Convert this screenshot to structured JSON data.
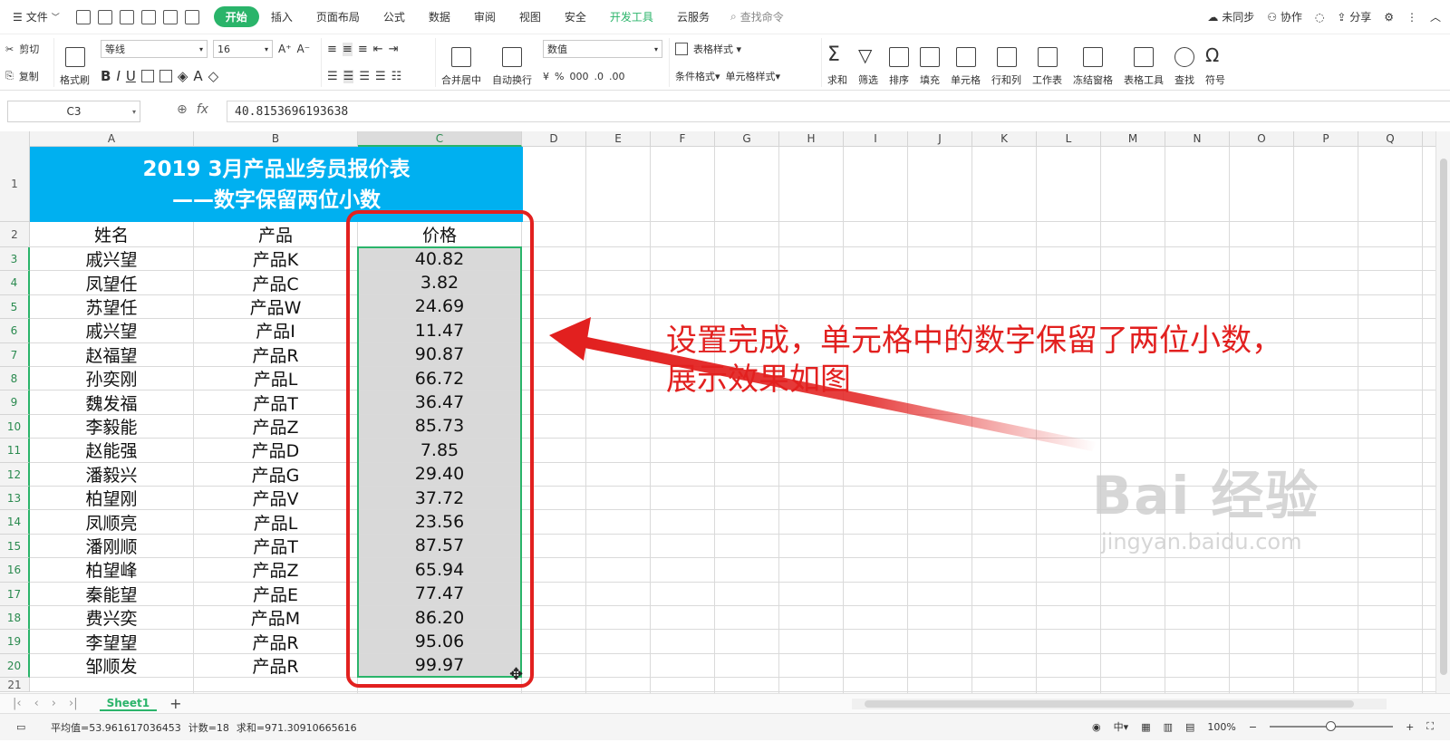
{
  "menu": {
    "file_label": "文件",
    "tabs": [
      "开始",
      "插入",
      "页面布局",
      "公式",
      "数据",
      "审阅",
      "视图",
      "安全",
      "开发工具",
      "云服务"
    ],
    "search_label": "查找命令",
    "right": {
      "sync": "未同步",
      "collab": "协作",
      "share": "分享"
    }
  },
  "ribbon": {
    "cut": "剪切",
    "copy": "复制",
    "format_painter": "格式刷",
    "font_name": "等线",
    "font_size": "16",
    "merge_center": "合并居中",
    "wrap_text": "自动换行",
    "number_format": "数值",
    "table_style": "表格样式",
    "cond_format": "条件格式",
    "cell_style": "单元格样式",
    "sum": "求和",
    "filter": "筛选",
    "sort": "排序",
    "fill": "填充",
    "cell": "单元格",
    "row_col": "行和列",
    "worksheet": "工作表",
    "freeze": "冻结窗格",
    "table_tools": "表格工具",
    "find": "查找",
    "symbol": "符号"
  },
  "formula_bar": {
    "cell_ref": "C3",
    "fx": "fx",
    "value": "40.8153696193638"
  },
  "columns": [
    "A",
    "B",
    "C",
    "D",
    "E",
    "F",
    "G",
    "H",
    "I",
    "J",
    "K",
    "L",
    "M",
    "N",
    "O",
    "P",
    "Q"
  ],
  "sheet": {
    "title_line1": "2019 3月产品业务员报价表",
    "title_line2": "——数字保留两位小数",
    "headers": {
      "name": "姓名",
      "product": "产品",
      "price": "价格"
    },
    "rows": [
      {
        "row": "3",
        "name": "戚兴望",
        "product": "产品K",
        "price": "40.82"
      },
      {
        "row": "4",
        "name": "凤望任",
        "product": "产品C",
        "price": "3.82"
      },
      {
        "row": "5",
        "name": "苏望任",
        "product": "产品W",
        "price": "24.69"
      },
      {
        "row": "6",
        "name": "戚兴望",
        "product": "产品I",
        "price": "11.47"
      },
      {
        "row": "7",
        "name": "赵福望",
        "product": "产品R",
        "price": "90.87"
      },
      {
        "row": "8",
        "name": "孙奕刚",
        "product": "产品L",
        "price": "66.72"
      },
      {
        "row": "9",
        "name": "魏发福",
        "product": "产品T",
        "price": "36.47"
      },
      {
        "row": "10",
        "name": "李毅能",
        "product": "产品Z",
        "price": "85.73"
      },
      {
        "row": "11",
        "name": "赵能强",
        "product": "产品D",
        "price": "7.85"
      },
      {
        "row": "12",
        "name": "潘毅兴",
        "product": "产品G",
        "price": "29.40"
      },
      {
        "row": "13",
        "name": "柏望刚",
        "product": "产品V",
        "price": "37.72"
      },
      {
        "row": "14",
        "name": "凤顺亮",
        "product": "产品L",
        "price": "23.56"
      },
      {
        "row": "15",
        "name": "潘刚顺",
        "product": "产品T",
        "price": "87.57"
      },
      {
        "row": "16",
        "name": "柏望峰",
        "product": "产品Z",
        "price": "65.94"
      },
      {
        "row": "17",
        "name": "秦能望",
        "product": "产品E",
        "price": "77.47"
      },
      {
        "row": "18",
        "name": "费兴奕",
        "product": "产品M",
        "price": "86.20"
      },
      {
        "row": "19",
        "name": "李望望",
        "product": "产品R",
        "price": "95.06"
      },
      {
        "row": "20",
        "name": "邹顺发",
        "product": "产品R",
        "price": "99.97"
      }
    ]
  },
  "annotation": {
    "line1": "设置完成，单元格中的数字保留了两位小数，",
    "line2": "展示效果如图"
  },
  "watermark": {
    "brand": "Bai 经验",
    "url": "jingyan.baidu.com"
  },
  "sheet_tabs": {
    "active": "Sheet1"
  },
  "status": {
    "average": "平均值=53.961617036453",
    "count": "计数=18",
    "sum": "求和=971.30910665616",
    "zoom": "100%"
  },
  "colors": {
    "accent": "#2ab46a",
    "title_bg": "#00b0f0",
    "annotation": "#e2201f"
  }
}
